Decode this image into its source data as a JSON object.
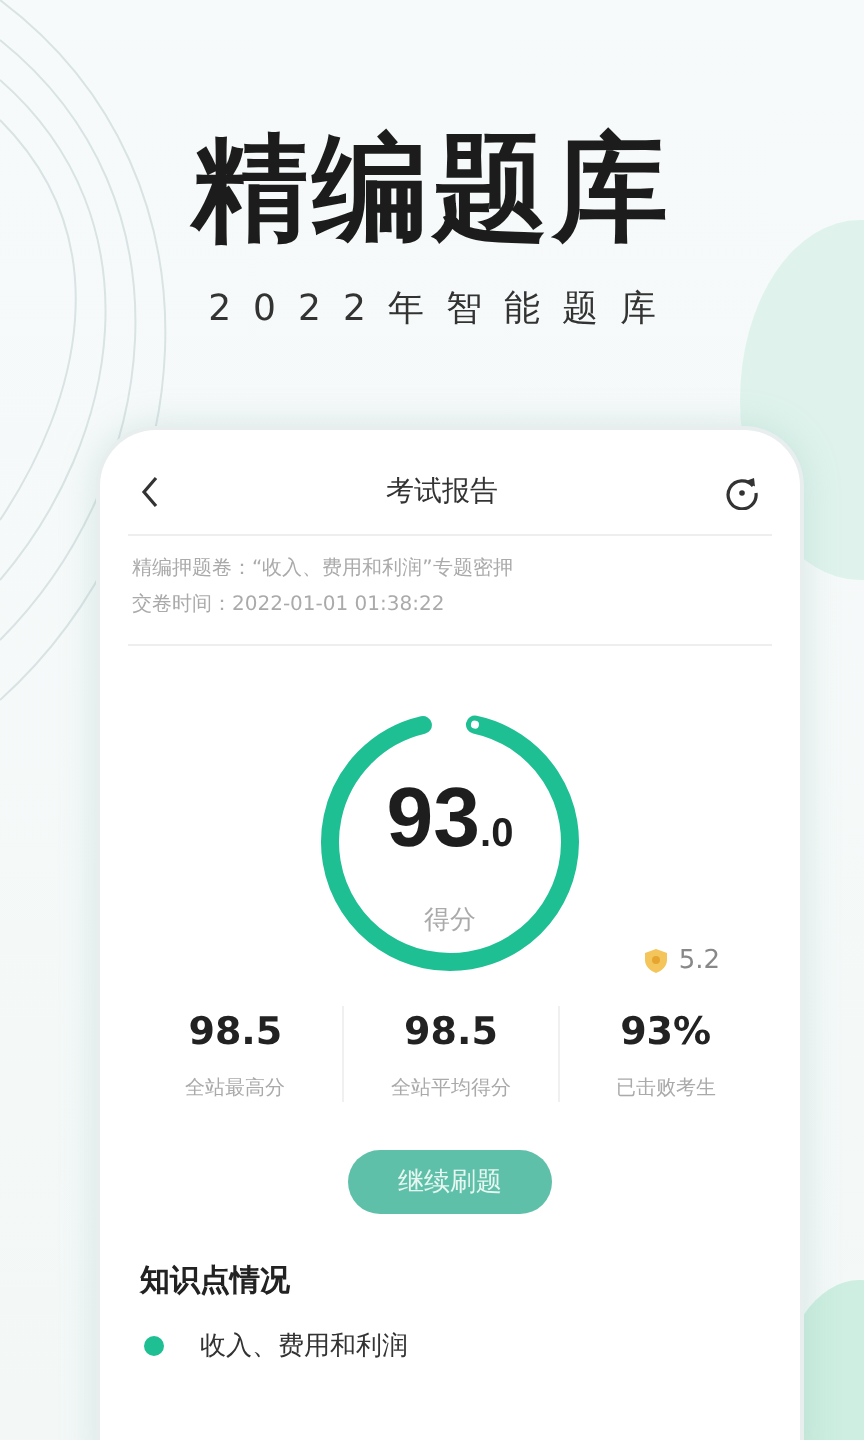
{
  "headline": "精编题库",
  "subline": "2022年智能题库",
  "screen": {
    "title": "考试报告",
    "paper": "精编押题卷：“收入、费用和利润”专题密押",
    "submit_time": "交卷时间：2022-01-01 01:38:22",
    "score": {
      "main": "93",
      "decimal": ".0",
      "label": "得分",
      "level": 0.93
    },
    "badge_value": "5.2",
    "stats": [
      {
        "value": "98.5",
        "label": "全站最高分"
      },
      {
        "value": "98.5",
        "label": "全站平均得分"
      },
      {
        "value": "93%",
        "label": "已击败考生"
      }
    ],
    "continue_button": "继续刷题",
    "section_title": "知识点情况",
    "knowledge_points": [
      {
        "name": "收入、费用和利润"
      }
    ]
  }
}
